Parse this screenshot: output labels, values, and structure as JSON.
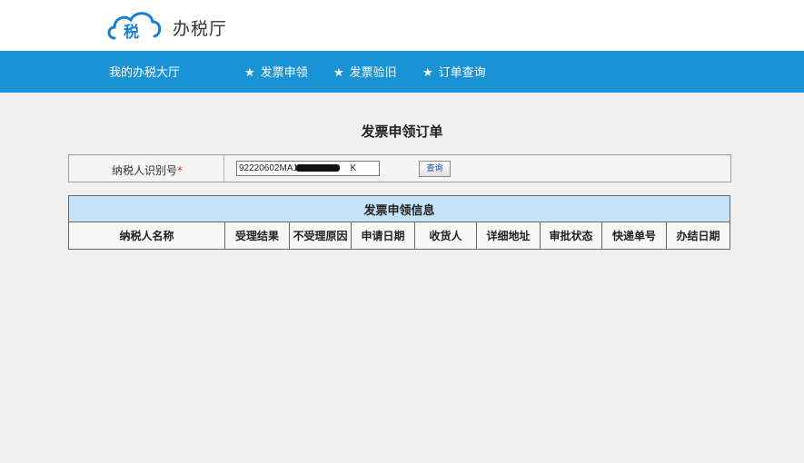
{
  "header": {
    "logo_glyph": "税",
    "title": "办税厅"
  },
  "nav": {
    "home": "我的办税大厅",
    "star": "★",
    "items": [
      {
        "label": "发票申领"
      },
      {
        "label": "发票验旧"
      },
      {
        "label": "订单查询"
      }
    ]
  },
  "page": {
    "title": "发票申领订单"
  },
  "query": {
    "label": "纳税人识别号",
    "required_mark": "*",
    "taxid_value": "92220602MA14",
    "taxid_suffix": "K",
    "button": "查询"
  },
  "table": {
    "caption": "发票申领信息",
    "columns": [
      "纳税人名称",
      "受理结果",
      "不受理原因",
      "申请日期",
      "收货人",
      "详细地址",
      "审批状态",
      "快递单号",
      "办结日期"
    ]
  },
  "colors": {
    "nav_bg": "#1a93d6",
    "logo_blue": "#1a7fd0",
    "caption_bg": "#c6e2f7",
    "content_bg": "#f0f0f0",
    "required": "#d21"
  }
}
